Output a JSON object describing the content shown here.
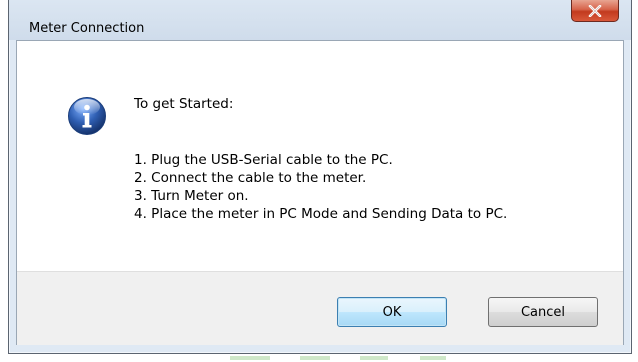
{
  "window": {
    "title": "Meter Connection",
    "close_glyph": "x-icon"
  },
  "message": {
    "icon": "info-icon",
    "heading": "To get Started:",
    "steps": [
      "1. Plug the USB-Serial cable to the PC.",
      "2. Connect the cable to the meter.",
      "3. Turn Meter on.",
      "4. Place the meter in PC Mode and Sending Data to PC."
    ]
  },
  "buttons": {
    "ok_label": "OK",
    "cancel_label": "Cancel"
  },
  "colors": {
    "close_button": "#c94a2e",
    "info_icon": "#2f5fb3",
    "default_button_border": "#3c7fb1"
  }
}
